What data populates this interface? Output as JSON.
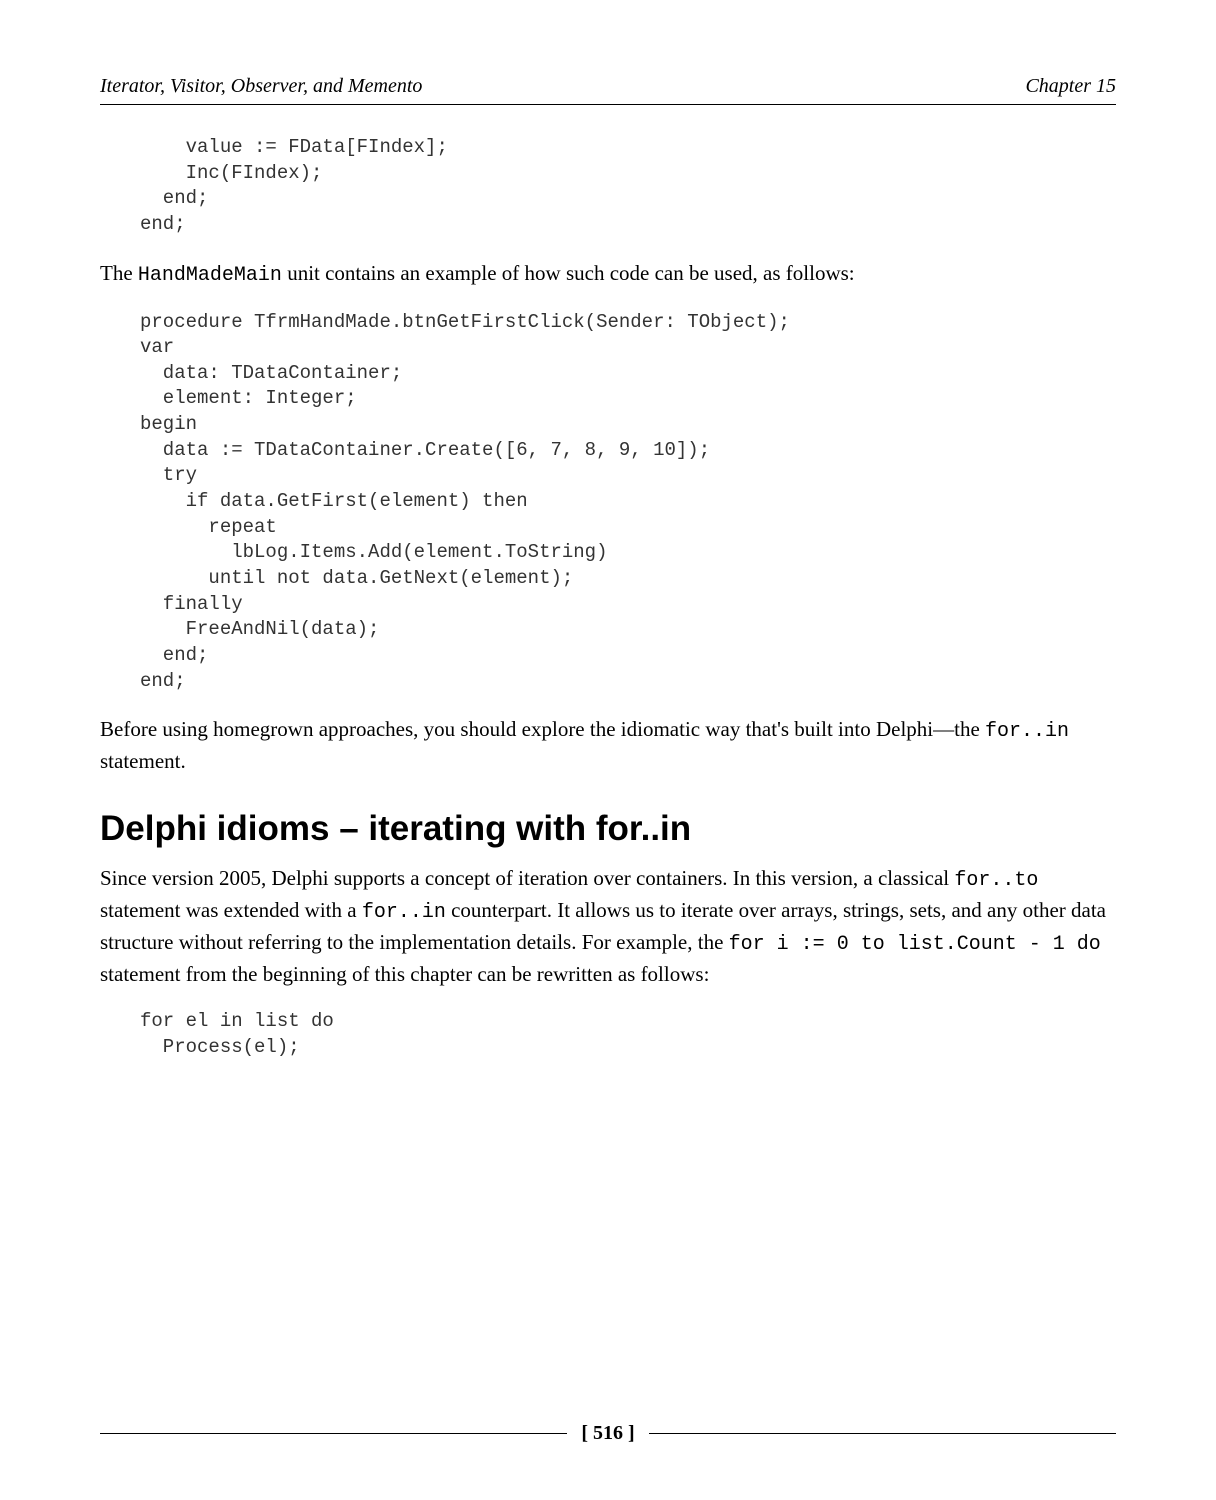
{
  "header": {
    "left": "Iterator, Visitor, Observer, and Memento",
    "right": "Chapter 15"
  },
  "code1": "    value := FData[FIndex];\n    Inc(FIndex);\n  end;\nend;",
  "para1_pre": "The ",
  "para1_code": "HandMadeMain",
  "para1_post": " unit contains an example of how such code can be used, as follows:",
  "code2": "procedure TfrmHandMade.btnGetFirstClick(Sender: TObject);\nvar\n  data: TDataContainer;\n  element: Integer;\nbegin\n  data := TDataContainer.Create([6, 7, 8, 9, 10]);\n  try\n    if data.GetFirst(element) then\n      repeat\n        lbLog.Items.Add(element.ToString)\n      until not data.GetNext(element);\n  finally\n    FreeAndNil(data);\n  end;\nend;",
  "para2_pre": "Before using homegrown approaches, you should explore the idiomatic way that's built into Delphi—the ",
  "para2_code": "for..in",
  "para2_post": " statement.",
  "heading": "Delphi idioms – iterating with for..in",
  "para3_a": "Since version 2005, Delphi supports a concept of iteration over containers. In this version, a classical ",
  "para3_code1": "for..to",
  "para3_b": " statement was extended with a ",
  "para3_code2": "for..in",
  "para3_c": " counterpart. It allows us to iterate over arrays, strings, sets, and any other data structure without referring to the implementation details. For example, the ",
  "para3_code3": "for i := 0 to list.Count - 1 do",
  "para3_d": " statement from the beginning of this chapter can be rewritten as follows:",
  "code3": "for el in list do\n  Process(el);",
  "footer": {
    "page": "[ 516 ]"
  }
}
